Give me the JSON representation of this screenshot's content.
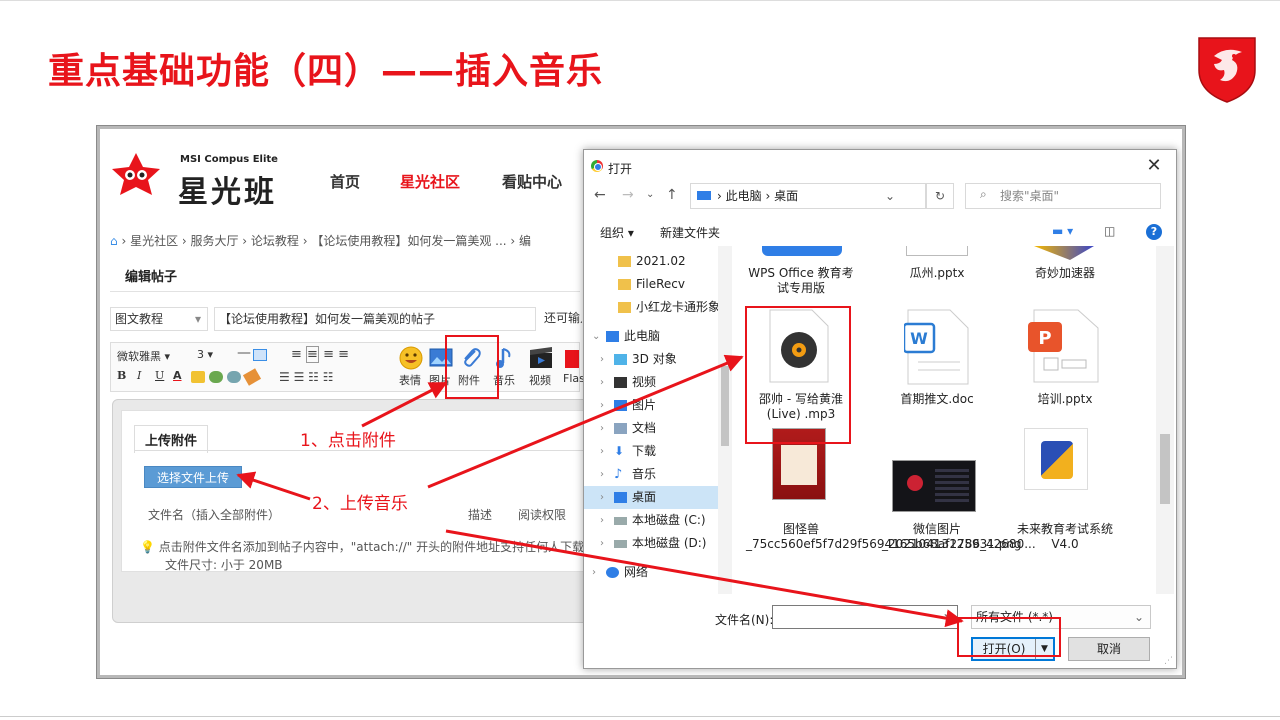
{
  "slide": {
    "title": "重点基础功能（四）——插入音乐",
    "accent": "#e8141b"
  },
  "forum": {
    "brand_small": "MSI Compus Elite",
    "brand": "星光班",
    "nav": [
      "首页",
      "星光社区",
      "看贴中心"
    ],
    "breadcrumb": "› 星光社区 › 服务大厅 › 论坛教程 › 【论坛使用教程】如何发一篇美观 ... › 编",
    "edit_tab": "编辑帖子",
    "category": "图文教程",
    "post_title": "【论坛使用教程】如何发一篇美观的帖子",
    "extra_text": "还可输入",
    "toolbar": {
      "font": "微软雅黑",
      "size": "3",
      "bold": "B",
      "italic": "I",
      "underline": "U",
      "color_a": "A",
      "emoji_label": "表情",
      "image_label": "图片",
      "attach_label": "附件",
      "music_label": "音乐",
      "video_label": "视频",
      "flash_label": "Flas"
    },
    "upload": {
      "tab": "上传附件",
      "button": "选择文件上传",
      "col_filename": "文件名（插入全部附件）",
      "col_desc": "描述",
      "col_perm": "阅读权限",
      "tip": "点击附件文件名添加到帖子内容中，\"attach://\" 开头的附件地址支持任何人下载",
      "size_limit": "文件尺寸: 小于 20MB"
    },
    "annotations": {
      "step1": "1、点击附件",
      "step2": "2、上传音乐"
    }
  },
  "dialog": {
    "title": "打开",
    "address": [
      "此电脑",
      "桌面"
    ],
    "search_placeholder": "搜索\"桌面\"",
    "organize": "组织 ▾",
    "new_folder": "新建文件夹",
    "tree": [
      {
        "label": "2021.02",
        "icon": "folder-icon"
      },
      {
        "label": "FileRecv",
        "icon": "folder-icon"
      },
      {
        "label": "小红龙卡通形象!",
        "icon": "folder-icon"
      },
      {
        "label": "此电脑",
        "icon": "computer-icon"
      },
      {
        "label": "3D 对象",
        "icon": "cube-icon"
      },
      {
        "label": "视频",
        "icon": "video-icon"
      },
      {
        "label": "图片",
        "icon": "image-icon"
      },
      {
        "label": "文档",
        "icon": "document-icon"
      },
      {
        "label": "下载",
        "icon": "download-icon"
      },
      {
        "label": "音乐",
        "icon": "music-icon"
      },
      {
        "label": "桌面",
        "icon": "desktop-icon"
      },
      {
        "label": "本地磁盘 (C:)",
        "icon": "drive-icon"
      },
      {
        "label": "本地磁盘 (D:)",
        "icon": "drive-icon"
      },
      {
        "label": "网络",
        "icon": "network-icon"
      }
    ],
    "files": [
      {
        "name": "WPS Office 教育考试专用版",
        "icon": "shortcut-icon"
      },
      {
        "name": "瓜州.pptx",
        "icon": "file-icon"
      },
      {
        "name": "奇妙加速器",
        "icon": "app-icon"
      },
      {
        "name": "邵帅 - 写给黄淮 (Live) .mp3",
        "icon": "music-file-icon"
      },
      {
        "name": "首期推文.doc",
        "icon": "word-icon"
      },
      {
        "name": "培训.pptx",
        "icon": "ppt-icon"
      },
      {
        "name": "图怪兽_75cc560ef5f7d29f5694165b68af2786_42680...",
        "icon": "image-file-icon"
      },
      {
        "name": "微信图片_20210413125931.png",
        "icon": "image-file-icon"
      },
      {
        "name": "未来教育考试系统V4.0",
        "icon": "app-icon"
      }
    ],
    "filename_label": "文件名(N):",
    "filename_value": "",
    "filetype": "所有文件 (*.*)",
    "open": "打开(O)",
    "cancel": "取消"
  }
}
